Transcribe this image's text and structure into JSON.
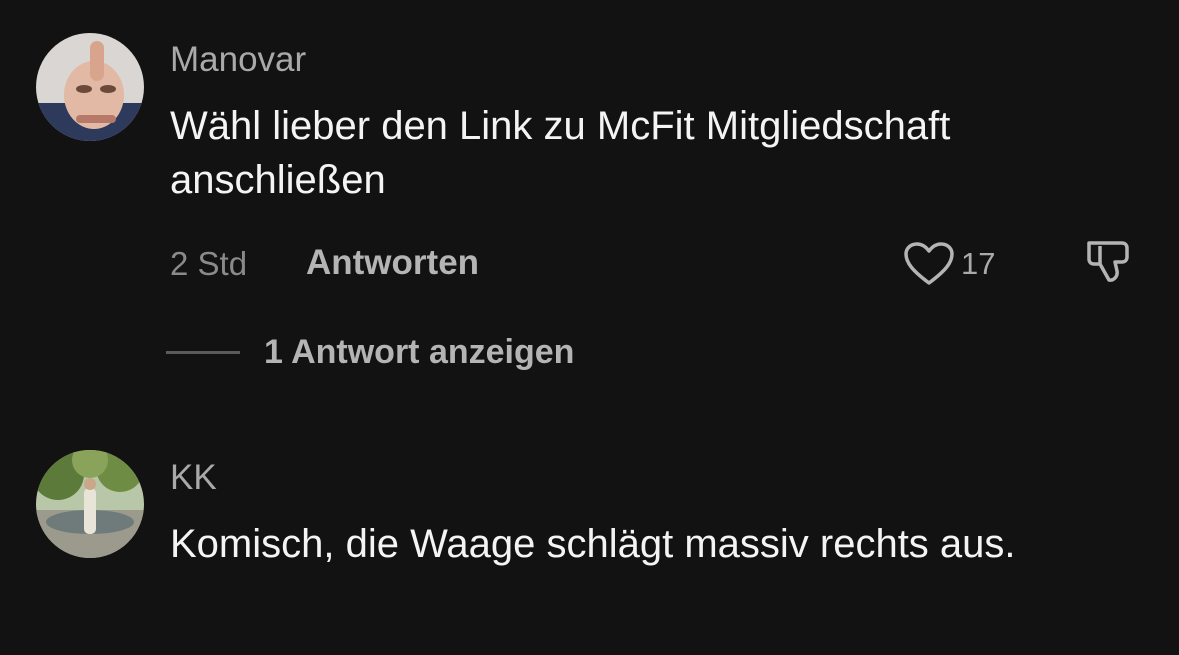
{
  "comments": [
    {
      "username": "Manovar",
      "text": "Wähl lieber den Link zu McFit Mitgliedschaft anschließen",
      "time": "2 Std",
      "reply_label": "Antworten",
      "likes": "17",
      "replies_label": "1 Antwort anzeigen",
      "avatar_icon": "avatar-thumbs-up-photo"
    },
    {
      "username": "KK",
      "text": "Komisch, die Waage schlägt massiv rechts aus.",
      "avatar_icon": "avatar-park-fountain-photo"
    }
  ],
  "colors": {
    "background": "#121212",
    "text": "#f4f4f4",
    "muted": "#a9a9a9"
  }
}
